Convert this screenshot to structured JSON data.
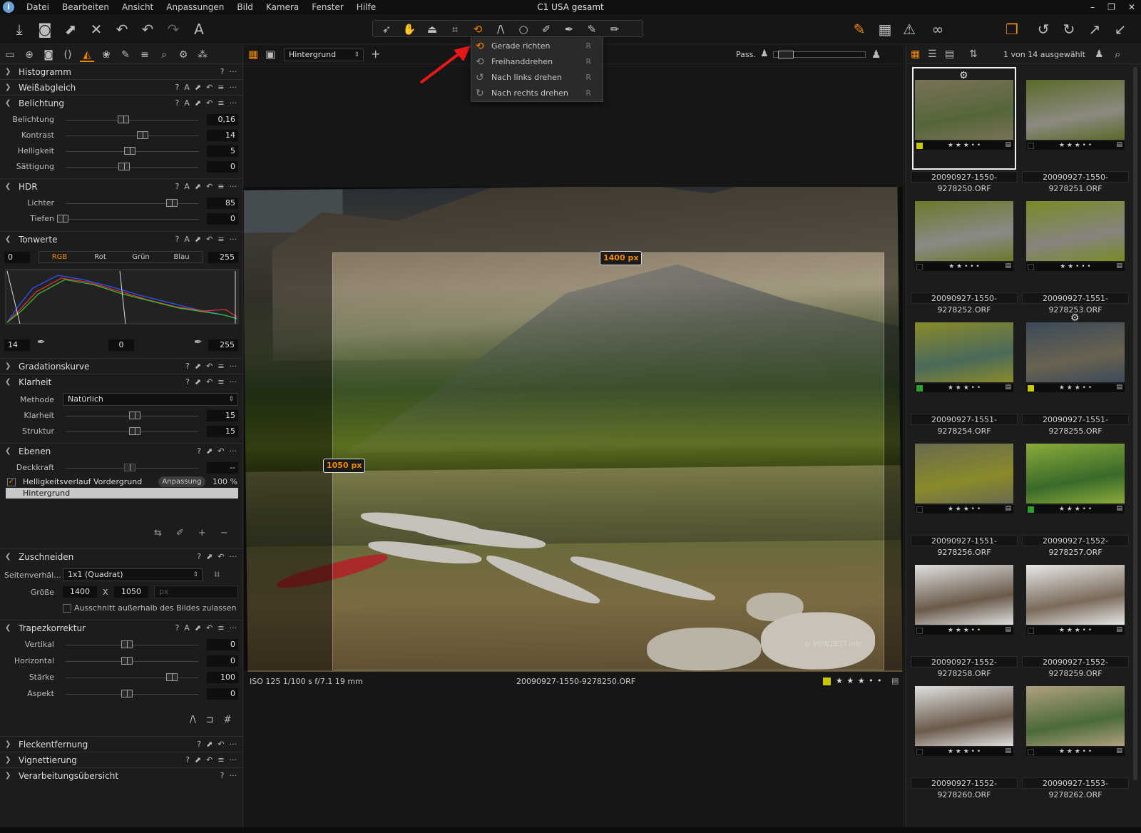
{
  "menubar": {
    "app_icon": "i",
    "items": [
      "Datei",
      "Bearbeiten",
      "Ansicht",
      "Anpassungen",
      "Bild",
      "Kamera",
      "Fenster",
      "Hilfe"
    ],
    "title": "C1 USA gesamt",
    "win_controls": [
      "–",
      "❐",
      "✕"
    ]
  },
  "toolbar": {
    "left_icons": [
      "import-icon",
      "camera-icon",
      "export-icon",
      "delete-icon",
      "undo-all-icon",
      "undo-icon",
      "redo-icon",
      "text-icon"
    ],
    "group_icons": [
      "cursor-tool-icon",
      "pan-tool-icon",
      "loupe-tool-icon",
      "crop-tool-icon",
      "rotate-tool-icon",
      "keystone-tool-icon",
      "spot-tool-icon",
      "brush-tool-icon",
      "picker-tool-icon",
      "eraser-tool-icon",
      "gradient-tool-icon"
    ],
    "right_icons": [
      "edit-icon",
      "grid-icon",
      "warning-icon",
      "glasses-icon",
      "stack-icon",
      "rotate-left-icon",
      "rotate-right-icon",
      "expand-icon",
      "collapse-icon"
    ],
    "accent": "#f08a00"
  },
  "rotate_menu": {
    "items": [
      {
        "label": "Gerade richten",
        "key": "R"
      },
      {
        "label": "Freihanddrehen",
        "key": "R"
      },
      {
        "label": "Nach links drehen",
        "key": "R"
      },
      {
        "label": "Nach rechts drehen",
        "key": "R"
      }
    ]
  },
  "left_panel": {
    "tabs": [
      "library-icon",
      "capture-icon",
      "camera-icon",
      "lens-icon",
      "exposure-icon",
      "color-icon",
      "details-icon",
      "metadata-icon",
      "search-icon",
      "settings-icon",
      "adjustments-icon"
    ],
    "histogramm": {
      "title": "Histogramm"
    },
    "weissabgleich": {
      "title": "Weißabgleich"
    },
    "belichtung": {
      "title": "Belichtung",
      "rows": [
        {
          "label": "Belichtung",
          "value": "0,16",
          "pos": 0.47
        },
        {
          "label": "Kontrast",
          "value": "14",
          "pos": 0.62
        },
        {
          "label": "Helligkeit",
          "value": "5",
          "pos": 0.52
        },
        {
          "label": "Sättigung",
          "value": "0",
          "pos": 0.48
        }
      ]
    },
    "hdr": {
      "title": "HDR",
      "rows": [
        {
          "label": "Lichter",
          "value": "85",
          "pos": 0.85
        },
        {
          "label": "Tiefen",
          "value": "0",
          "pos": 0.0
        }
      ]
    },
    "tonwerte": {
      "title": "Tonwerte",
      "left_val": "0",
      "right_val": "255",
      "channels": [
        "RGB",
        "Rot",
        "Grün",
        "Blau"
      ],
      "bottom_left": "14",
      "bottom_mid": "0",
      "bottom_right": "255"
    },
    "gradationskurve": {
      "title": "Gradationskurve"
    },
    "klarheit": {
      "title": "Klarheit",
      "methode_label": "Methode",
      "methode_value": "Natürlich",
      "rows": [
        {
          "label": "Klarheit",
          "value": "15",
          "pos": 0.56
        },
        {
          "label": "Struktur",
          "value": "15",
          "pos": 0.56
        }
      ]
    },
    "ebenen": {
      "title": "Ebenen",
      "deckkraft_label": "Deckkraft",
      "deckkraft_value": "--",
      "layer1": "Helligkeitsverlauf Vordergrund",
      "layer1_badge": "Anpassung",
      "layer1_pct": "100 %",
      "layer2": "Hintergrund"
    },
    "zuschneiden": {
      "title": "Zuschneiden",
      "ratio_label": "Seitenverhäl...",
      "ratio_value": "1x1 (Quadrat)",
      "size_label": "Größe",
      "w": "1400",
      "x": "X",
      "h": "1050",
      "unit": "px",
      "allow_label": "Ausschnitt außerhalb des Bildes zulassen"
    },
    "trapez": {
      "title": "Trapezkorrektur",
      "rows": [
        {
          "label": "Vertikal",
          "value": "0",
          "pos": 0.5
        },
        {
          "label": "Horizontal",
          "value": "0",
          "pos": 0.5
        },
        {
          "label": "Stärke",
          "value": "100",
          "pos": 0.85
        },
        {
          "label": "Aspekt",
          "value": "0",
          "pos": 0.5
        }
      ]
    },
    "fleckentfernung": {
      "title": "Fleckentfernung"
    },
    "vignettierung": {
      "title": "Vignettierung"
    },
    "verarbeitung": {
      "title": "Verarbeitungsübersicht"
    }
  },
  "viewer": {
    "layer_select": "Hintergrund",
    "pass_label": "Pass.",
    "crop_w_badge": "1400 px",
    "crop_h_badge": "1050 px",
    "status_exif": "ISO 125  1/100 s  f/7.1  19 mm",
    "status_file": "20090927-1550-9278250.ORF",
    "status_stars": "★ ★ ★ • •",
    "watermark": "© PEINZETT.info"
  },
  "browser": {
    "count_label": "1 von 14 ausgewählt",
    "thumbs": [
      {
        "name": "20090927-1550-9278250.ORF",
        "stars": "★ ★ ★ • •",
        "tag": "#c8c800",
        "selected": true,
        "gear": true,
        "c1": "#55663a",
        "c2": "#7a7258"
      },
      {
        "name": "20090927-1550-9278251.ORF",
        "stars": "★ ★ ★ • •",
        "tag": "",
        "selected": false,
        "gear": false,
        "c1": "#8c8a80",
        "c2": "#5a6a28"
      },
      {
        "name": "20090927-1550-9278252.ORF",
        "stars": "★ ★ • • •",
        "tag": "",
        "selected": false,
        "gear": false,
        "c1": "#8a8a86",
        "c2": "#6a7a2a"
      },
      {
        "name": "20090927-1551-9278253.ORF",
        "stars": "★ ★ • • •",
        "tag": "",
        "selected": false,
        "gear": false,
        "c1": "#86847e",
        "c2": "#7a8a26"
      },
      {
        "name": "20090927-1551-9278254.ORF",
        "stars": "★ ★ ★ • •",
        "tag": "#2ca02c",
        "selected": false,
        "gear": false,
        "c1": "#4a6a5a",
        "c2": "#8a8a2a"
      },
      {
        "name": "20090927-1551-9278255.ORF",
        "stars": "★ ★ ★ • •",
        "tag": "#c8c800",
        "selected": false,
        "gear": true,
        "c1": "#6a6250",
        "c2": "#3a4a5a"
      },
      {
        "name": "20090927-1551-9278256.ORF",
        "stars": "★ ★ ★ • •",
        "tag": "",
        "selected": false,
        "gear": false,
        "c1": "#8a8a2a",
        "c2": "#6a6a50"
      },
      {
        "name": "20090927-1552-9278257.ORF",
        "stars": "★ ★ ★ • •",
        "tag": "#2ca02c",
        "selected": false,
        "gear": false,
        "c1": "#3a6a2a",
        "c2": "#8aaa3a"
      },
      {
        "name": "20090927-1552-9278258.ORF",
        "stars": "★ ★ ★ • •",
        "tag": "",
        "selected": false,
        "gear": false,
        "c1": "#6a5a4a",
        "c2": "#e0e0e0"
      },
      {
        "name": "20090927-1552-9278259.ORF",
        "stars": "★ ★ ★ • •",
        "tag": "",
        "selected": false,
        "gear": false,
        "c1": "#7a6a5a",
        "c2": "#e8e8e8"
      },
      {
        "name": "20090927-1552-9278260.ORF",
        "stars": "★ ★ ★ • •",
        "tag": "",
        "selected": false,
        "gear": false,
        "c1": "#6a5a4a",
        "c2": "#e0e0e0"
      },
      {
        "name": "20090927-1553-9278262.ORF",
        "stars": "★ ★ ★ • •",
        "tag": "",
        "selected": false,
        "gear": false,
        "c1": "#4a6a3a",
        "c2": "#b0a080"
      }
    ]
  }
}
